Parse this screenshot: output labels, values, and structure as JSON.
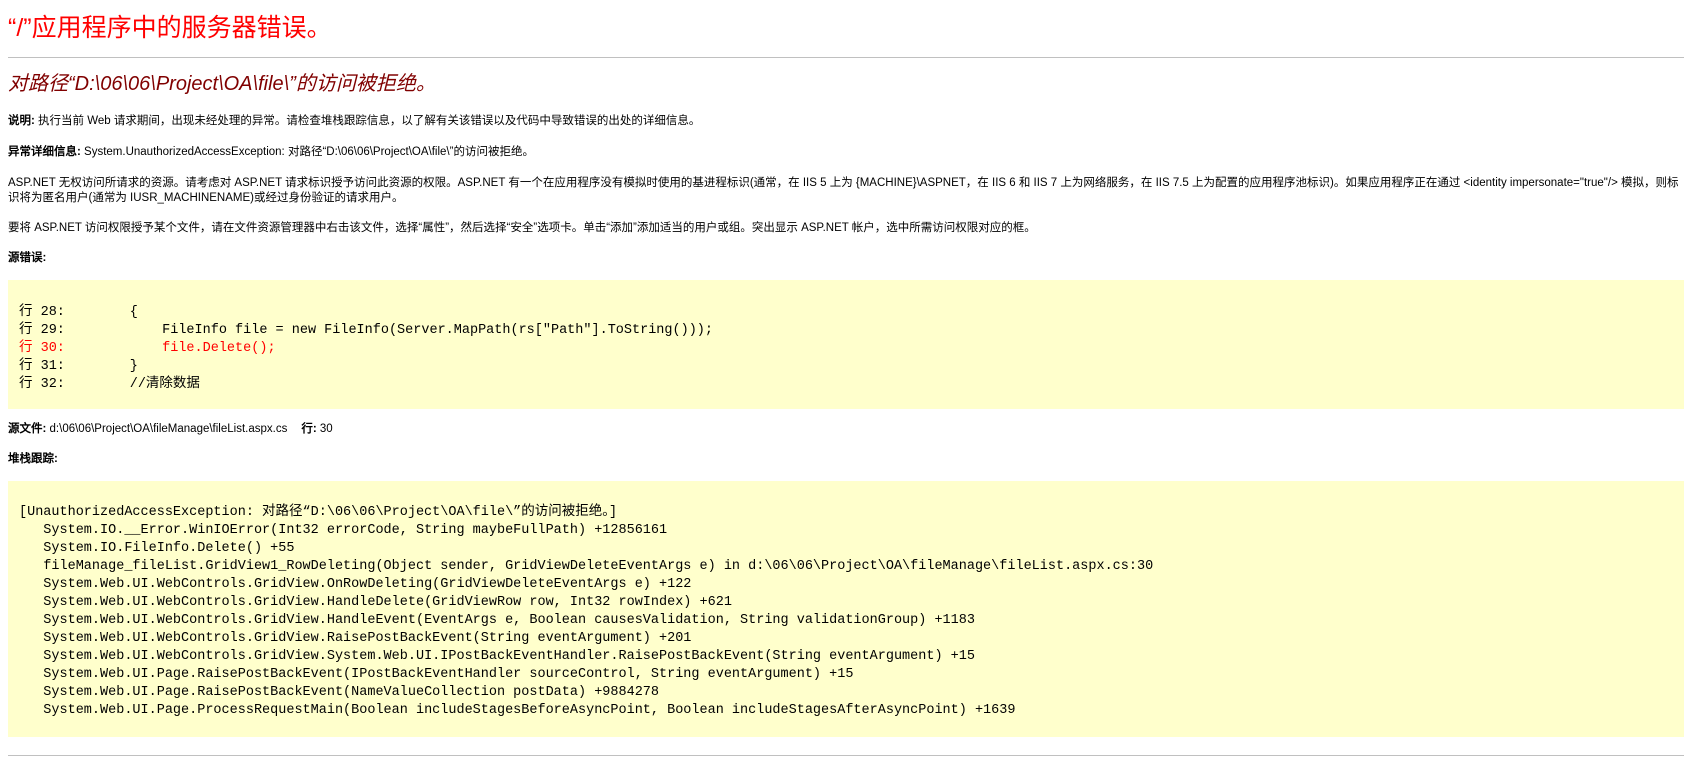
{
  "page": {
    "title": "“/”应用程序中的服务器错误。",
    "error_message": "对路径“D:\\06\\06\\Project\\OA\\file\\”的访问被拒绝。"
  },
  "description": {
    "label": "说明:",
    "text": " 执行当前 Web 请求期间，出现未经处理的异常。请检查堆栈跟踪信息，以了解有关该错误以及代码中导致错误的出处的详细信息。"
  },
  "exception_details": {
    "label": "异常详细信息:",
    "text": " System.UnauthorizedAccessException: 对路径“D:\\06\\06\\Project\\OA\\file\\”的访问被拒绝。"
  },
  "aspnet_note": "ASP.NET 无权访问所请求的资源。请考虑对 ASP.NET 请求标识授予访问此资源的权限。ASP.NET 有一个在应用程序没有模拟时使用的基进程标识(通常，在 IIS 5 上为 {MACHINE}\\ASPNET，在 IIS 6 和 IIS 7 上为网络服务，在 IIS 7.5 上为配置的应用程序池标识)。如果应用程序正在通过 <identity impersonate=\"true\"/> 模拟，则标识将为匿名用户(通常为 IUSR_MACHINENAME)或经过身份验证的请求用户。",
  "permission_note": "要将 ASP.NET 访问权限授予某个文件，请在文件资源管理器中右击该文件，选择“属性”，然后选择“安全”选项卡。单击“添加”添加适当的用户或组。突出显示 ASP.NET 帐户，选中所需访问权限对应的框。",
  "source_error": {
    "label": "源错误:",
    "lines": [
      "行 28:        {",
      "行 29:            FileInfo file = new FileInfo(Server.MapPath(rs[\"Path\"].ToString()));",
      "行 30:            file.Delete();",
      "行 31:        }",
      "行 32:        //清除数据"
    ],
    "error_line_index": 2
  },
  "source_file": {
    "label": "源文件:",
    "path": " d:\\06\\06\\Project\\OA\\fileManage\\fileList.aspx.cs",
    "line_label": "行:",
    "line_value": " 30"
  },
  "stack_trace": {
    "label": "堆栈跟踪:",
    "lines": [
      "[UnauthorizedAccessException: 对路径“D:\\06\\06\\Project\\OA\\file\\”的访问被拒绝。]",
      "   System.IO.__Error.WinIOError(Int32 errorCode, String maybeFullPath) +12856161",
      "   System.IO.FileInfo.Delete() +55",
      "   fileManage_fileList.GridView1_RowDeleting(Object sender, GridViewDeleteEventArgs e) in d:\\06\\06\\Project\\OA\\fileManage\\fileList.aspx.cs:30",
      "   System.Web.UI.WebControls.GridView.OnRowDeleting(GridViewDeleteEventArgs e) +122",
      "   System.Web.UI.WebControls.GridView.HandleDelete(GridViewRow row, Int32 rowIndex) +621",
      "   System.Web.UI.WebControls.GridView.HandleEvent(EventArgs e, Boolean causesValidation, String validationGroup) +1183",
      "   System.Web.UI.WebControls.GridView.RaisePostBackEvent(String eventArgument) +201",
      "   System.Web.UI.WebControls.GridView.System.Web.UI.IPostBackEventHandler.RaisePostBackEvent(String eventArgument) +15",
      "   System.Web.UI.Page.RaisePostBackEvent(IPostBackEventHandler sourceControl, String eventArgument) +15",
      "   System.Web.UI.Page.RaisePostBackEvent(NameValueCollection postData) +9884278",
      "   System.Web.UI.Page.ProcessRequestMain(Boolean includeStagesBeforeAsyncPoint, Boolean includeStagesAfterAsyncPoint) +1639"
    ]
  },
  "colors": {
    "title": "#ff0000",
    "error_message": "#800000",
    "code_background": "#ffffcc",
    "error_line": "#ff0000",
    "rule": "#c0c0c0"
  }
}
